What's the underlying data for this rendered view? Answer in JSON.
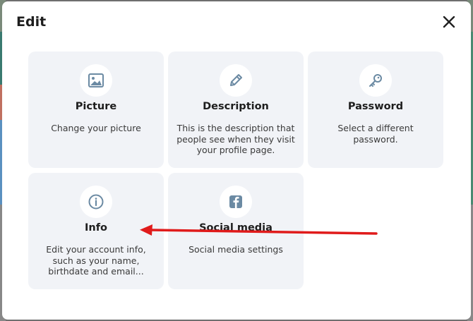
{
  "dialog": {
    "title": "Edit",
    "close_label": "close"
  },
  "cards": [
    {
      "title": "Picture",
      "description": "Change your picture",
      "icon": "image-icon"
    },
    {
      "title": "Description",
      "description": "This is the description that people see when they visit your profile page.",
      "icon": "pencil-icon"
    },
    {
      "title": "Password",
      "description": "Select a different password.",
      "icon": "key-icon"
    },
    {
      "title": "Info",
      "description": "Edit your account info, such as your name, birthdate and email...",
      "icon": "info-icon"
    },
    {
      "title": "Social media",
      "description": "Social media settings",
      "icon": "facebook-icon"
    }
  ],
  "colors": {
    "card_bg": "#f1f3f7",
    "icon_color": "#6b8aa3",
    "annotation_arrow": "#e01b1b"
  }
}
